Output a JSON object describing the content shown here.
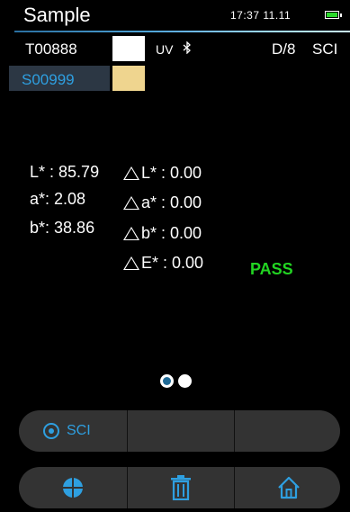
{
  "status": {
    "title": "Sample",
    "time": "17:37 11.11",
    "battery_icon": "battery-full-icon",
    "accent": "#2e9fe0"
  },
  "trial": {
    "id": "T00888",
    "swatch_color": "#ffffff",
    "uv": "UV",
    "bluetooth_icon": "bluetooth-icon",
    "geometry": "D/8",
    "mode": "SCI"
  },
  "standard": {
    "id": "S00999",
    "swatch_color": "#efd58f"
  },
  "lab": {
    "L_label": "L* : ",
    "L": "85.79",
    "a_label": "a*: ",
    "a": "2.08",
    "b_label": "b*: ",
    "b": "38.86"
  },
  "delta": {
    "dL_label": "L* : ",
    "dL": "0.00",
    "da_label": "a* : ",
    "da": "0.00",
    "db_label": "b* : ",
    "db": "0.00",
    "dE_label": "E* : ",
    "dE": "0.00"
  },
  "result": {
    "text": "PASS",
    "color": "#22d422"
  },
  "pager": {
    "pages": 2,
    "active": 1
  },
  "toolbar_top": {
    "sci_label": "SCI",
    "sci_icon": "target-icon"
  },
  "toolbar_bottom": {
    "measure_icon": "crosshair-icon",
    "delete_icon": "trash-icon",
    "home_icon": "home-icon"
  }
}
